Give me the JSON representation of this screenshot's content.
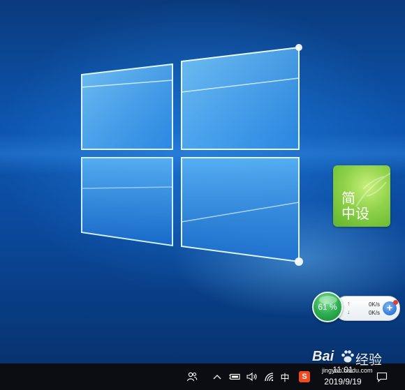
{
  "desktop": {
    "wallpaper": "Windows 10 hero wallpaper"
  },
  "widget": {
    "line1": "简",
    "line2": "中设",
    "color": "#8fd24a"
  },
  "net_monitor": {
    "usage_percent": "61 %",
    "upload_speed": "0K/s",
    "download_speed": "0K/s",
    "upload_icon": "arrow-up-icon",
    "download_icon": "arrow-down-icon",
    "plus_label": "+"
  },
  "taskbar": {
    "tray_icons": [
      "people-icon",
      "chevron-up-icon",
      "battery-icon",
      "volume-icon",
      "wifi-icon"
    ],
    "ime_label": "中",
    "sogou_label": "S",
    "clock_time": "11:01",
    "clock_date": "2019/9/19",
    "notification_icon": "notification-icon"
  },
  "watermark": {
    "brand": "Bai",
    "paw": "paw-icon",
    "brand_cn": "经验",
    "url": "jingyan.baidu.com"
  }
}
